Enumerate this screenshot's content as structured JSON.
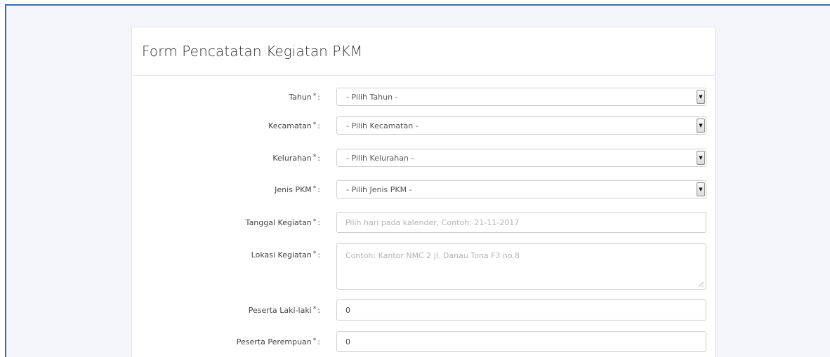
{
  "form": {
    "title": "Form Pencatatan Kegiatan PKM",
    "required_mark": "*",
    "colon": ":",
    "fields": {
      "tahun": {
        "label": "Tahun",
        "value": "- Pilih Tahun -"
      },
      "kecamatan": {
        "label": "Kecamatan",
        "value": "- Pilih Kecamatan -"
      },
      "kelurahan": {
        "label": "Kelurahan",
        "value": "- Pilih Kelurahan -"
      },
      "jenis_pkm": {
        "label": "Jenis PKM",
        "value": "- Pilih Jenis PKM -"
      },
      "tanggal": {
        "label": "Tanggal Kegiatan",
        "value": "",
        "placeholder": "Pilih hari pada kalender, Contoh: 21-11-2017"
      },
      "lokasi": {
        "label": "Lokasi Kegiatan",
        "value": "",
        "placeholder": "Contoh: Kantor NMC 2 jl. Danau Tona F3 no.8"
      },
      "peserta_laki": {
        "label": "Peserta Laki-laki",
        "value": "0"
      },
      "peserta_perempuan": {
        "label": "Peserta Perempuan",
        "value": "0"
      }
    }
  },
  "icons": {
    "dropdown": "dropdown-arrow-icon",
    "resize": "resize-grip-icon"
  },
  "colors": {
    "frame_border": "#3a6db0",
    "background": "#f4f5f8",
    "panel": "#ffffff"
  }
}
